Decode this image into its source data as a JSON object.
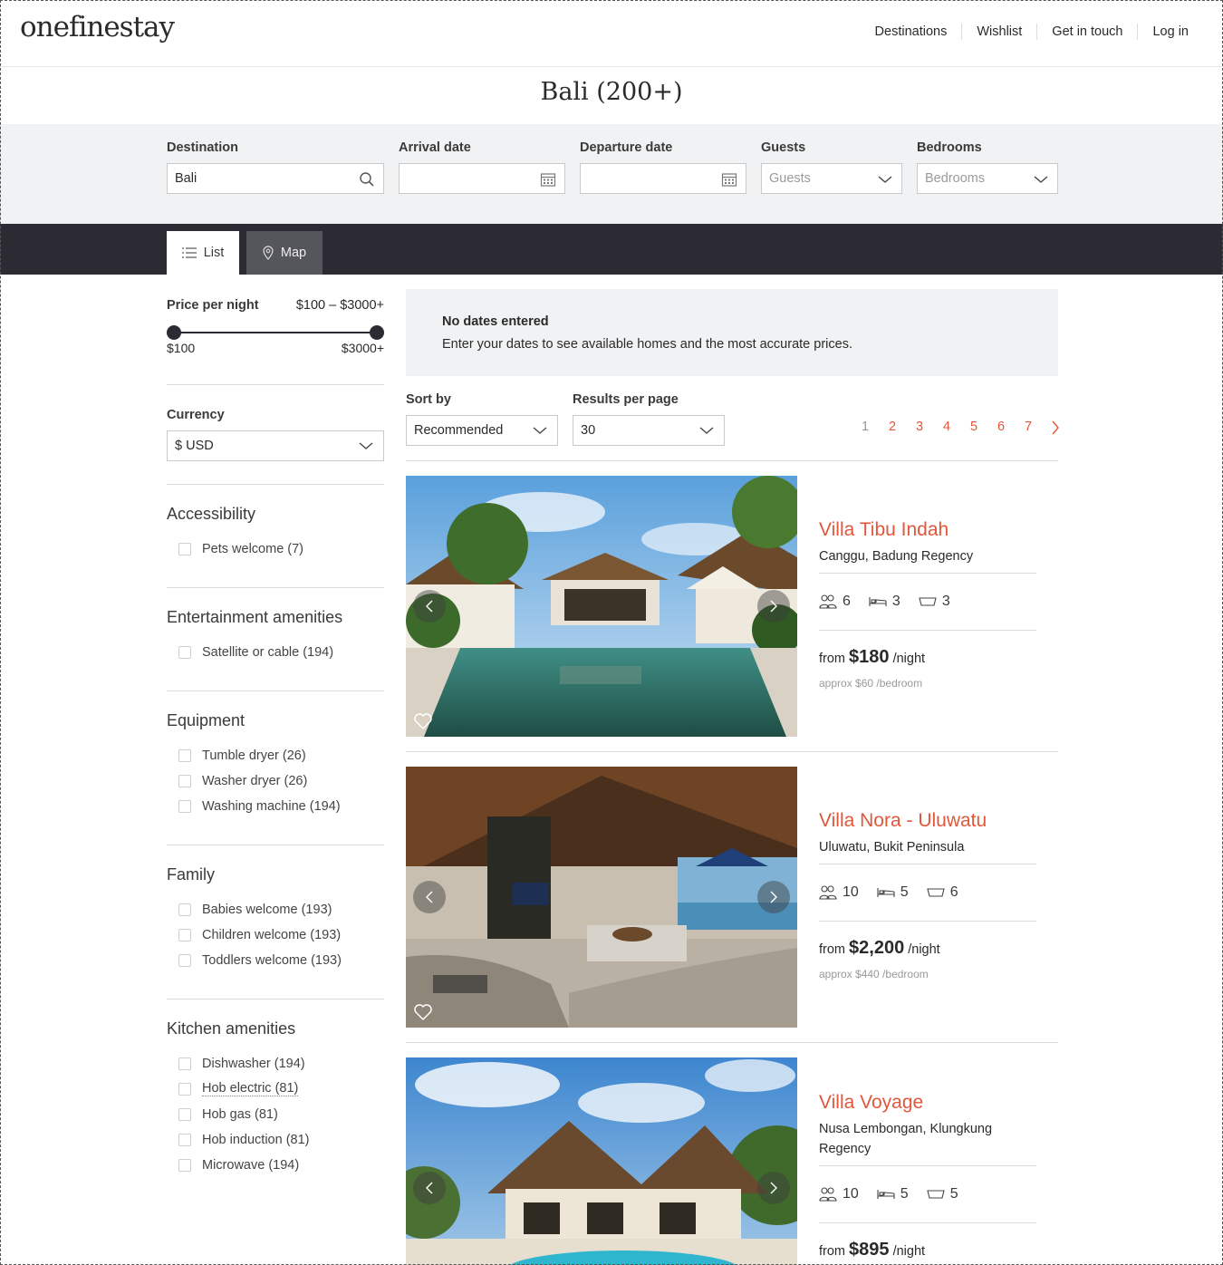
{
  "brand": "onefinestay",
  "nav": [
    "Destinations",
    "Wishlist",
    "Get in touch",
    "Log in"
  ],
  "page_title": "Bali (200+)",
  "search": {
    "destination_label": "Destination",
    "destination_value": "Bali",
    "arrival_label": "Arrival date",
    "departure_label": "Departure date",
    "guests_label": "Guests",
    "guests_placeholder": "Guests",
    "bedrooms_label": "Bedrooms",
    "bedrooms_placeholder": "Bedrooms"
  },
  "view_tabs": {
    "list": "List",
    "map": "Map",
    "active": "list"
  },
  "filters": {
    "price_label": "Price per night",
    "price_range": "$100 – $3000+",
    "price_min": "$100",
    "price_max": "$3000+",
    "currency_label": "Currency",
    "currency_value": "$ USD",
    "groups": [
      {
        "title": "Accessibility",
        "options": [
          "Pets welcome (7)"
        ]
      },
      {
        "title": "Entertainment amenities",
        "options": [
          "Satellite or cable (194)"
        ]
      },
      {
        "title": "Equipment",
        "options": [
          "Tumble dryer (26)",
          "Washer dryer (26)",
          "Washing machine (194)"
        ]
      },
      {
        "title": "Family",
        "options": [
          "Babies welcome (193)",
          "Children welcome (193)",
          "Toddlers welcome (193)"
        ]
      },
      {
        "title": "Kitchen amenities",
        "options": [
          "Dishwasher (194)",
          "Hob electric (81)",
          "Hob gas (81)",
          "Hob induction (81)",
          "Microwave (194)"
        ]
      }
    ]
  },
  "notice": {
    "heading": "No dates entered",
    "text": "Enter your dates to see available homes and the most accurate prices."
  },
  "sort": {
    "label": "Sort by",
    "value": "Recommended"
  },
  "per_page": {
    "label": "Results per page",
    "value": "30"
  },
  "pagination": {
    "pages": [
      "1",
      "2",
      "3",
      "4",
      "5",
      "6",
      "7"
    ],
    "current": "1"
  },
  "listings": [
    {
      "name": "Villa Tibu Indah",
      "location": "Canggu, Badung Regency",
      "guests": "6",
      "bedrooms": "3",
      "bathrooms": "3",
      "from": "from",
      "price": "$180",
      "per": "/night",
      "approx": "approx $60 /bedroom"
    },
    {
      "name": "Villa Nora - Uluwatu",
      "location": "Uluwatu, Bukit Peninsula",
      "guests": "10",
      "bedrooms": "5",
      "bathrooms": "6",
      "from": "from",
      "price": "$2,200",
      "per": "/night",
      "approx": "approx $440 /bedroom"
    },
    {
      "name": "Villa Voyage",
      "location": "Nusa Lembongan, Klungkung Regency",
      "guests": "10",
      "bedrooms": "5",
      "bathrooms": "5",
      "from": "from",
      "price": "$895",
      "per": "/night",
      "approx": ""
    }
  ],
  "colors": {
    "accent": "#e2563a",
    "dark_band": "#2c2a33",
    "panel": "#f1f2f3"
  },
  "icons": {
    "search": "search-icon",
    "calendar": "calendar-icon",
    "chevron": "chevron-down-icon",
    "list": "list-icon",
    "map": "map-pin-icon",
    "heart": "heart-icon",
    "guests": "guests-icon",
    "bed": "bed-icon",
    "bath": "bath-icon"
  }
}
